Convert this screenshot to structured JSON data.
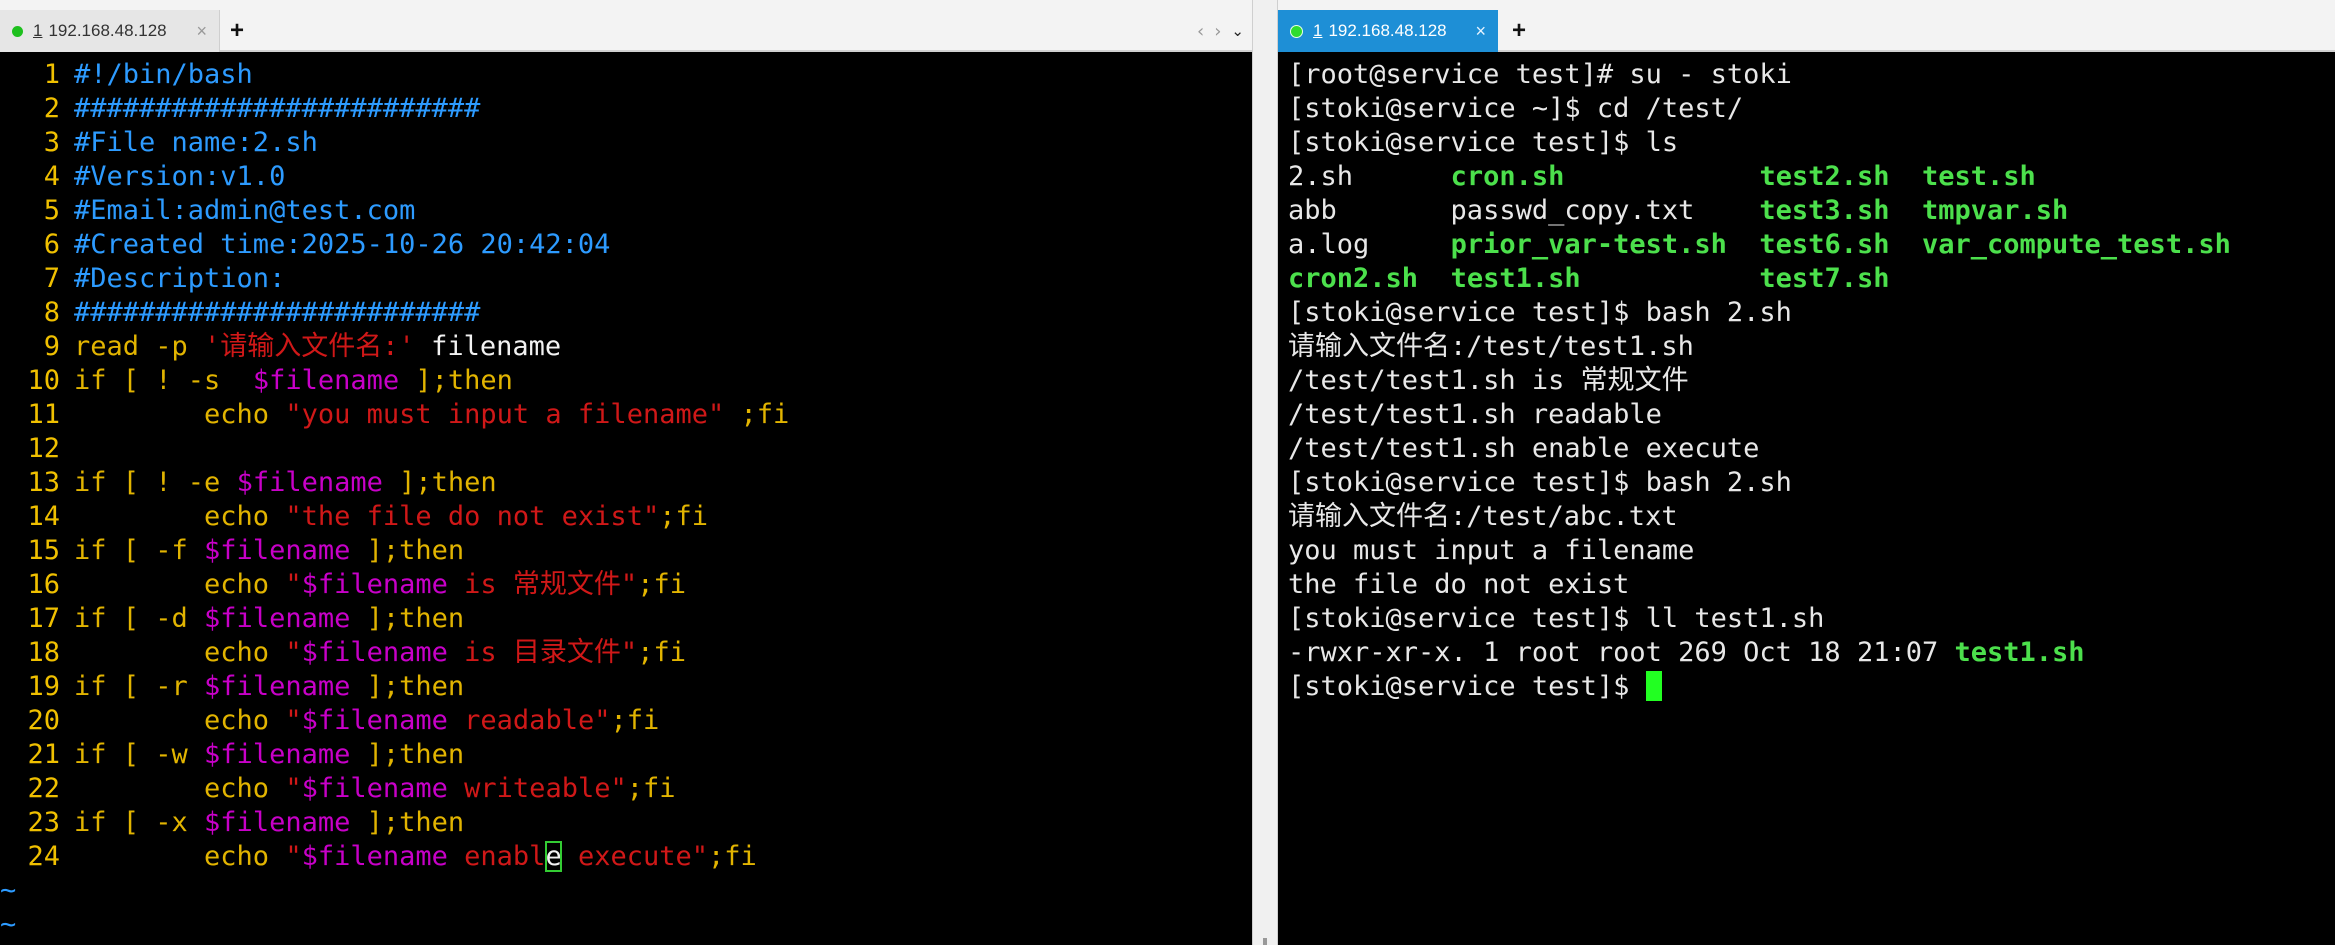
{
  "left_tab": {
    "num": "1",
    "title": "192.168.48.128",
    "close": "×"
  },
  "right_tab": {
    "num": "1",
    "title": "192.168.48.128",
    "close": "×"
  },
  "add_tab": "+",
  "nav": {
    "prev": "‹",
    "next": "›",
    "menu": "⌄"
  },
  "editor": {
    "lines": [
      {
        "n": "1",
        "parts": [
          {
            "c": "cmt",
            "t": "#!/bin/bash"
          }
        ]
      },
      {
        "n": "2",
        "parts": [
          {
            "c": "cmt",
            "t": "#########################"
          }
        ]
      },
      {
        "n": "3",
        "parts": [
          {
            "c": "cmt",
            "t": "#File name:2.sh"
          }
        ]
      },
      {
        "n": "4",
        "parts": [
          {
            "c": "cmt",
            "t": "#Version:v1.0"
          }
        ]
      },
      {
        "n": "5",
        "parts": [
          {
            "c": "cmt",
            "t": "#Email:admin@test.com"
          }
        ]
      },
      {
        "n": "6",
        "parts": [
          {
            "c": "cmt",
            "t": "#Created time:2025-10-26 20:42:04"
          }
        ]
      },
      {
        "n": "7",
        "parts": [
          {
            "c": "cmt",
            "t": "#Description:"
          }
        ]
      },
      {
        "n": "8",
        "parts": [
          {
            "c": "cmt",
            "t": "#########################"
          }
        ]
      },
      {
        "n": "9",
        "parts": [
          {
            "c": "kw",
            "t": "read -p "
          },
          {
            "c": "str",
            "t": "'请输入文件名:'"
          },
          {
            "c": "txt",
            "t": " filename"
          }
        ]
      },
      {
        "n": "10",
        "parts": [
          {
            "c": "kw",
            "t": "if [ ! -s  "
          },
          {
            "c": "var",
            "t": "$filename"
          },
          {
            "c": "kw",
            "t": " ];then"
          }
        ]
      },
      {
        "n": "11",
        "parts": [
          {
            "c": "kw",
            "t": "        echo "
          },
          {
            "c": "str",
            "t": "\"you must input a filename\""
          },
          {
            "c": "kw",
            "t": " ;fi"
          }
        ]
      },
      {
        "n": "12",
        "parts": []
      },
      {
        "n": "13",
        "parts": [
          {
            "c": "kw",
            "t": "if [ ! -e "
          },
          {
            "c": "var",
            "t": "$filename"
          },
          {
            "c": "kw",
            "t": " ];then"
          }
        ]
      },
      {
        "n": "14",
        "parts": [
          {
            "c": "kw",
            "t": "        echo "
          },
          {
            "c": "str",
            "t": "\"the file do not exist\""
          },
          {
            "c": "kw",
            "t": ";fi"
          }
        ]
      },
      {
        "n": "15",
        "parts": [
          {
            "c": "kw",
            "t": "if [ -f "
          },
          {
            "c": "var",
            "t": "$filename"
          },
          {
            "c": "kw",
            "t": " ];then"
          }
        ]
      },
      {
        "n": "16",
        "parts": [
          {
            "c": "kw",
            "t": "        echo "
          },
          {
            "c": "str",
            "t": "\""
          },
          {
            "c": "var",
            "t": "$filename"
          },
          {
            "c": "str",
            "t": " is 常规文件\""
          },
          {
            "c": "kw",
            "t": ";fi"
          }
        ]
      },
      {
        "n": "17",
        "parts": [
          {
            "c": "kw",
            "t": "if [ -d "
          },
          {
            "c": "var",
            "t": "$filename"
          },
          {
            "c": "kw",
            "t": " ];then"
          }
        ]
      },
      {
        "n": "18",
        "parts": [
          {
            "c": "kw",
            "t": "        echo "
          },
          {
            "c": "str",
            "t": "\""
          },
          {
            "c": "var",
            "t": "$filename"
          },
          {
            "c": "str",
            "t": " is 目录文件\""
          },
          {
            "c": "kw",
            "t": ";fi"
          }
        ]
      },
      {
        "n": "19",
        "parts": [
          {
            "c": "kw",
            "t": "if [ -r "
          },
          {
            "c": "var",
            "t": "$filename"
          },
          {
            "c": "kw",
            "t": " ];then"
          }
        ]
      },
      {
        "n": "20",
        "parts": [
          {
            "c": "kw",
            "t": "        echo "
          },
          {
            "c": "str",
            "t": "\""
          },
          {
            "c": "var",
            "t": "$filename"
          },
          {
            "c": "str",
            "t": " readable\""
          },
          {
            "c": "kw",
            "t": ";fi"
          }
        ]
      },
      {
        "n": "21",
        "parts": [
          {
            "c": "kw",
            "t": "if [ -w "
          },
          {
            "c": "var",
            "t": "$filename"
          },
          {
            "c": "kw",
            "t": " ];then"
          }
        ]
      },
      {
        "n": "22",
        "parts": [
          {
            "c": "kw",
            "t": "        echo "
          },
          {
            "c": "str",
            "t": "\""
          },
          {
            "c": "var",
            "t": "$filename"
          },
          {
            "c": "str",
            "t": " writeable\""
          },
          {
            "c": "kw",
            "t": ";fi"
          }
        ]
      },
      {
        "n": "23",
        "parts": [
          {
            "c": "kw",
            "t": "if [ -x "
          },
          {
            "c": "var",
            "t": "$filename"
          },
          {
            "c": "kw",
            "t": " ];then"
          }
        ]
      },
      {
        "n": "24",
        "parts": [
          {
            "c": "kw",
            "t": "        echo "
          },
          {
            "c": "str",
            "t": "\""
          },
          {
            "c": "var",
            "t": "$filename"
          },
          {
            "c": "str",
            "t": " enabl"
          },
          {
            "c": "cursor-e",
            "t": "e"
          },
          {
            "c": "str",
            "t": " execute\""
          },
          {
            "c": "kw",
            "t": ";fi"
          }
        ]
      }
    ],
    "tildes": [
      "~",
      "~"
    ]
  },
  "terminal": {
    "lines": [
      [
        {
          "c": "",
          "t": "[root@service test]# su - stoki"
        }
      ],
      [
        {
          "c": "",
          "t": "[stoki@service ~]$ cd /test/"
        }
      ],
      [
        {
          "c": "",
          "t": "[stoki@service test]$ ls"
        }
      ],
      [
        {
          "c": "",
          "t": "2.sh      "
        },
        {
          "c": "exe",
          "t": "cron.sh"
        },
        {
          "c": "",
          "t": "            "
        },
        {
          "c": "exe",
          "t": "test2.sh"
        },
        {
          "c": "",
          "t": "  "
        },
        {
          "c": "exe",
          "t": "test.sh"
        }
      ],
      [
        {
          "c": "",
          "t": "abb       passwd_copy.txt    "
        },
        {
          "c": "exe",
          "t": "test3.sh"
        },
        {
          "c": "",
          "t": "  "
        },
        {
          "c": "exe",
          "t": "tmpvar.sh"
        }
      ],
      [
        {
          "c": "",
          "t": "a.log     "
        },
        {
          "c": "exe",
          "t": "prior_var-test.sh"
        },
        {
          "c": "",
          "t": "  "
        },
        {
          "c": "exe",
          "t": "test6.sh"
        },
        {
          "c": "",
          "t": "  "
        },
        {
          "c": "exe",
          "t": "var_compute_test.sh"
        }
      ],
      [
        {
          "c": "exe",
          "t": "cron2.sh"
        },
        {
          "c": "",
          "t": "  "
        },
        {
          "c": "exe",
          "t": "test1.sh"
        },
        {
          "c": "",
          "t": "           "
        },
        {
          "c": "exe",
          "t": "test7.sh"
        }
      ],
      [
        {
          "c": "",
          "t": "[stoki@service test]$ bash 2.sh"
        }
      ],
      [
        {
          "c": "",
          "t": "请输入文件名:/test/test1.sh"
        }
      ],
      [
        {
          "c": "",
          "t": "/test/test1.sh is 常规文件"
        }
      ],
      [
        {
          "c": "",
          "t": "/test/test1.sh readable"
        }
      ],
      [
        {
          "c": "",
          "t": "/test/test1.sh enable execute"
        }
      ],
      [
        {
          "c": "",
          "t": "[stoki@service test]$ bash 2.sh"
        }
      ],
      [
        {
          "c": "",
          "t": "请输入文件名:/test/abc.txt"
        }
      ],
      [
        {
          "c": "",
          "t": "you must input a filename"
        }
      ],
      [
        {
          "c": "",
          "t": "the file do not exist"
        }
      ],
      [
        {
          "c": "",
          "t": "[stoki@service test]$ ll test1.sh"
        }
      ],
      [
        {
          "c": "",
          "t": "-rwxr-xr-x. 1 root root 269 Oct 18 21:07 "
        },
        {
          "c": "exe",
          "t": "test1.sh"
        }
      ],
      [
        {
          "c": "",
          "t": "[stoki@service test]$ "
        },
        {
          "c": "cursor",
          "t": ""
        }
      ]
    ]
  },
  "colors": {
    "comment": "#2d9bff",
    "keyword": "#e2b400",
    "variable": "#c800c8",
    "string": "#d01818",
    "exec": "#4ce04c",
    "tab_active": "#1e8fd6"
  }
}
